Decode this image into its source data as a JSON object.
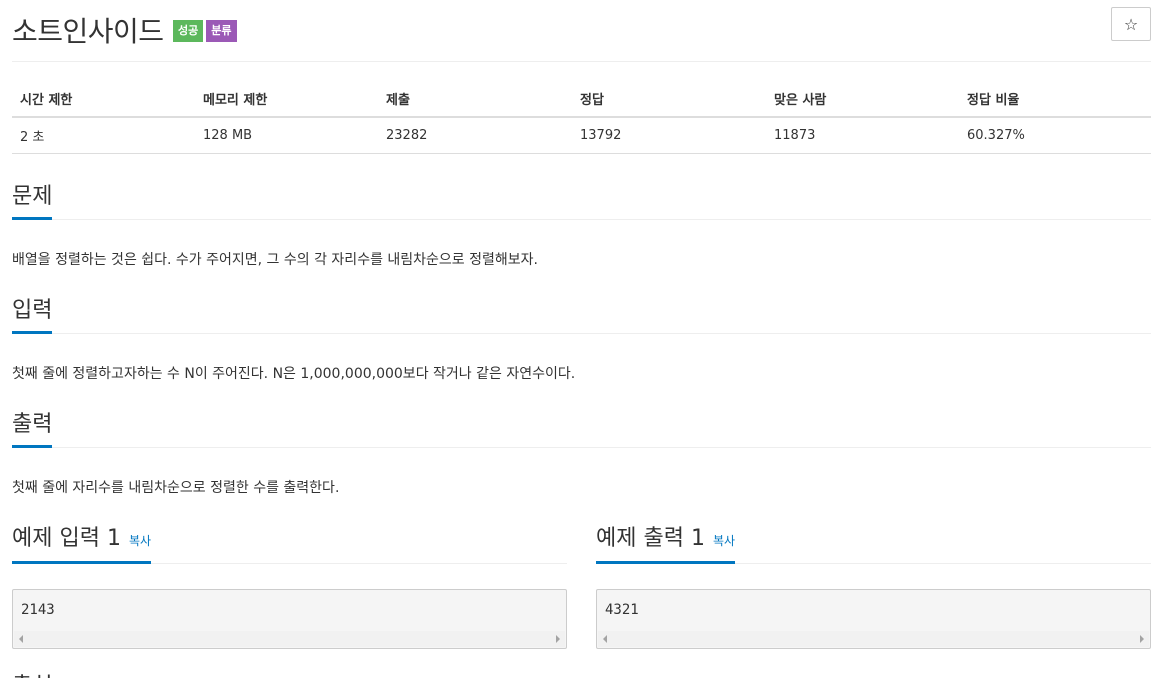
{
  "problem": {
    "title": "소트인사이드",
    "badges": {
      "success": "성공",
      "category": "분류"
    },
    "star_icon": "star-icon"
  },
  "info_table": {
    "headers": [
      "시간 제한",
      "메모리 제한",
      "제출",
      "정답",
      "맞은 사람",
      "정답 비율"
    ],
    "values": [
      "2 초",
      "128 MB",
      "23282",
      "13792",
      "11873",
      "60.327%"
    ]
  },
  "sections": {
    "description": {
      "title": "문제",
      "body": "배열을 정렬하는 것은 쉽다. 수가 주어지면, 그 수의 각 자리수를 내림차순으로 정렬해보자."
    },
    "input": {
      "title": "입력",
      "body": "첫째 줄에 정렬하고자하는 수 N이 주어진다. N은 1,000,000,000보다 작거나 같은 자연수이다."
    },
    "output": {
      "title": "출력",
      "body": "첫째 줄에 자리수를 내림차순으로 정렬한 수를 출력한다."
    }
  },
  "samples": {
    "input": {
      "title": "예제 입력 1",
      "copy_label": "복사",
      "content": "2143"
    },
    "output": {
      "title": "예제 출력 1",
      "copy_label": "복사",
      "content": "4321"
    }
  },
  "next_section_partial": "출처"
}
